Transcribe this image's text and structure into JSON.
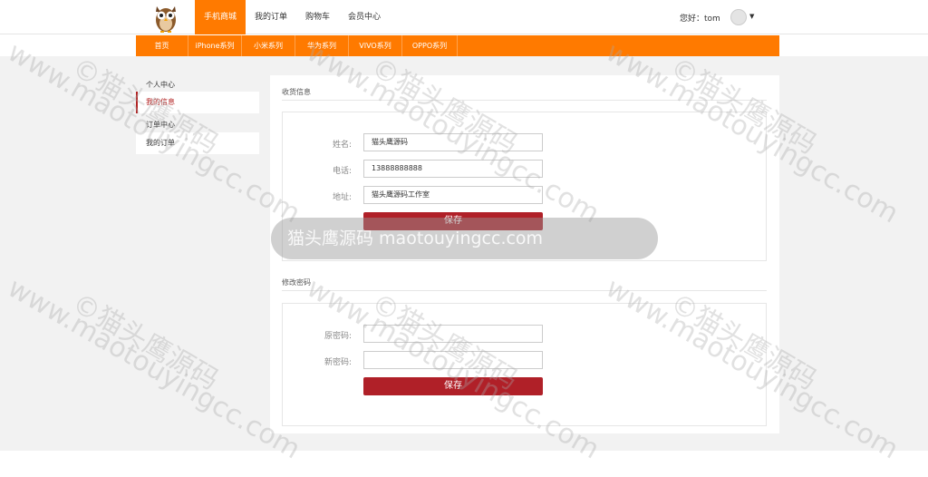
{
  "header": {
    "nav": [
      "手机商城",
      "我的订单",
      "购物车",
      "会员中心"
    ],
    "active_index": 0,
    "greeting": "您好：tom"
  },
  "categories": [
    "首页",
    "iPhone系列",
    "小米系列",
    "华为系列",
    "VIVO系列",
    "OPPO系列"
  ],
  "sidebar": {
    "groups": [
      {
        "title": "个人中心",
        "items": [
          "我的信息"
        ]
      },
      {
        "title": "订单中心",
        "items": [
          "我的订单"
        ]
      }
    ]
  },
  "profile": {
    "section_title": "收货信息",
    "name_label": "姓名:",
    "name_value": "猫头鹰源码",
    "phone_label": "电话:",
    "phone_value": "13888888888",
    "address_label": "地址:",
    "address_value": "猫头鹰源码工作室",
    "save_label": "保存"
  },
  "password": {
    "section_title": "修改密码",
    "old_label": "原密码:",
    "new_label": "新密码:",
    "save_label": "保存"
  },
  "watermark": {
    "url": "www.maotouyingcc.com",
    "brand": "©猫头鹰源码",
    "pill": "猫头鹰源码 maotouyingcc.com"
  },
  "colors": {
    "accent": "#ff7a00",
    "save_button": "#b02028",
    "active_sidebar": "#b22222"
  }
}
